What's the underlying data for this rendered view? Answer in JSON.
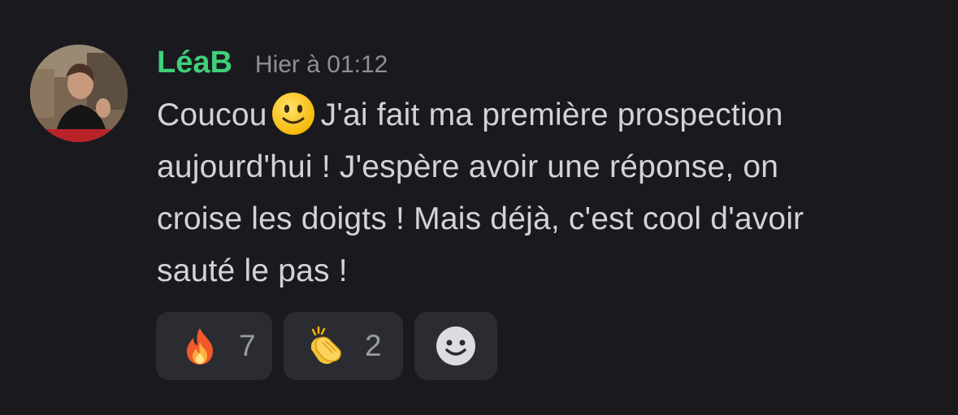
{
  "message": {
    "username": "LéaB",
    "timestamp": "Hier à 01:12",
    "lines": [
      "Coucou",
      "J'ai fait ma première prospection",
      "aujourd'hui ! J'espère avoir une réponse, on",
      "croise les doigts ! Mais déjà, c'est cool d'avoir",
      "sauté le pas !"
    ],
    "inline_emoji": "slightly-smiling-face"
  },
  "reactions": [
    {
      "emoji": "fire",
      "count": "7"
    },
    {
      "emoji": "clapping-hands",
      "count": "2"
    }
  ],
  "add_reaction_icon": "add-reaction-smiley",
  "colors": {
    "background": "#1a1a1e",
    "username": "#3fcf7a",
    "timestamp": "#8e9098",
    "text": "#d2d3d7",
    "reaction_bg": "#2b2c31"
  }
}
